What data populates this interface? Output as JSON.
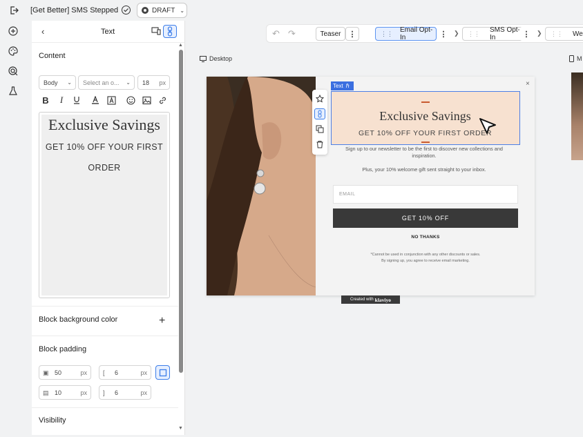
{
  "topbar": {
    "title": "[Get Better] SMS Stepped",
    "status": "DRAFT"
  },
  "panel": {
    "header_title": "Text",
    "content_label": "Content",
    "style_select": "Body",
    "font_select_placeholder": "Select an o...",
    "font_size": "18",
    "font_size_unit": "px",
    "editor_title": "Exclusive Savings",
    "editor_subtitle": "GET 10% OFF YOUR FIRST ORDER",
    "block_background_label": "Block background color",
    "block_padding_label": "Block padding",
    "padding": {
      "left": "50",
      "right": "6",
      "bottom": "10",
      "top": "6",
      "unit": "px"
    },
    "visibility_label": "Visibility"
  },
  "steps": {
    "teaser": "Teaser",
    "email_optin": "Email Opt-In",
    "sms_optin": "SMS Opt-In",
    "wedding": "Weddi"
  },
  "views": {
    "desktop": "Desktop",
    "mobile": "M"
  },
  "popup": {
    "tag_label": "Text",
    "title": "Exclusive Savings",
    "subtitle": "GET 10% OFF YOUR FIRST ORDER",
    "desc1": "Sign up to our newsletter to be the first to discover new collections and inspiration.",
    "desc2": "Plus, your 10% welcome gift sent straight to your inbox.",
    "email_placeholder": "EMAIL",
    "cta": "GET 10% OFF",
    "no_thanks": "NO THANKS",
    "fine1": "*Cannot be used in conjunction with any other discounts or sales.",
    "fine2": "By signing up, you agree to receive email marketing.",
    "close": "×",
    "badge_prefix": "Created with",
    "badge_brand": "klaviyo"
  },
  "colors": {
    "accent": "#3b6fe0",
    "cta_bg": "#393939",
    "text_block_bg": "#f7e1d0"
  }
}
